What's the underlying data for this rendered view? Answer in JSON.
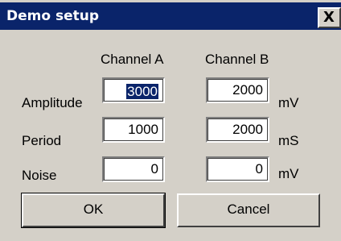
{
  "window": {
    "title": "Demo setup",
    "close_label": "X"
  },
  "columns": {
    "channel_a": "Channel A",
    "channel_b": "Channel B"
  },
  "rows": [
    {
      "label": "Amplitude",
      "channel_a": "3000",
      "channel_b": "2000",
      "unit": "mV"
    },
    {
      "label": "Period",
      "channel_a": "1000",
      "channel_b": "2000",
      "unit": "mS"
    },
    {
      "label": "Noise",
      "channel_a": "0",
      "channel_b": "0",
      "unit": "mV"
    }
  ],
  "buttons": {
    "ok": "OK",
    "cancel": "Cancel"
  },
  "colors": {
    "titlebar": "#0a246a",
    "face": "#d4d0c8",
    "selection": "#0a246a"
  },
  "icons": {
    "close": "close-icon"
  }
}
